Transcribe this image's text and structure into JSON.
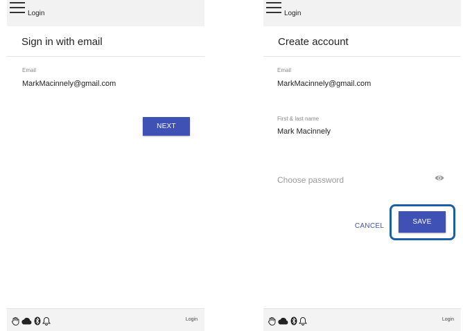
{
  "left": {
    "appbar_title": "Login",
    "page_title": "Sign in with email",
    "email_label": "Email",
    "email_value": "MarkMacinnely@gmail.com",
    "next_label": "NEXT",
    "status_label": "Login"
  },
  "right": {
    "appbar_title": "Login",
    "page_title": "Create account",
    "email_label": "Email",
    "email_value": "MarkMacinnely@gmail.com",
    "name_label": "First & last name",
    "name_value": "Mark Macinnely",
    "password_placeholder": "Choose password",
    "cancel_label": "CANCEL",
    "save_label": "SAVE",
    "status_label": "Login"
  },
  "colors": {
    "primary": "#3f51b5",
    "highlight": "#1b5ea8"
  },
  "icons": [
    "menu-icon",
    "hand-icon",
    "cloud-icon",
    "bluetooth-icon",
    "bell-icon",
    "eye-icon"
  ]
}
